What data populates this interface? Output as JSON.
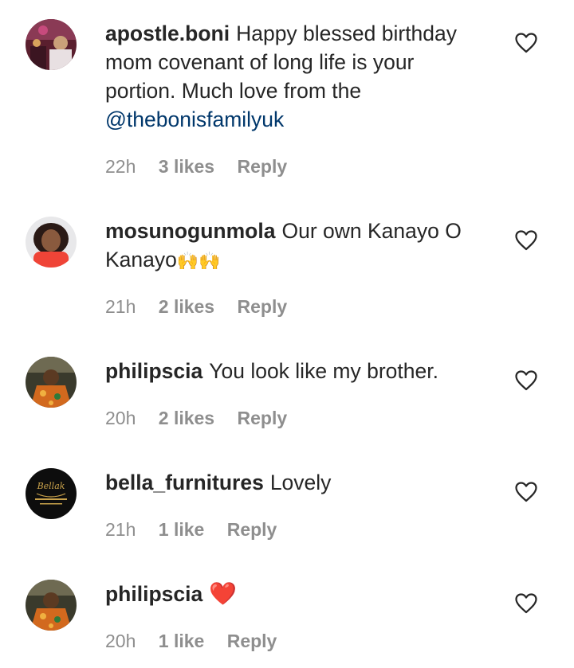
{
  "comments": [
    {
      "username": "apostle.boni",
      "text": "Happy blessed birthday mom covenant of long life is your portion. Much love from the",
      "mention": "@thebonisfamilyuk",
      "time": "22h",
      "likes": "3 likes",
      "reply": "Reply",
      "avatar_icon": "photo-avatar"
    },
    {
      "username": "mosunogunmola",
      "text": "Our own Kanayo O Kanayo",
      "emoji": "🙌🙌",
      "time": "21h",
      "likes": "2 likes",
      "reply": "Reply",
      "avatar_icon": "photo-avatar"
    },
    {
      "username": "philipscia",
      "text": "You look like my brother.",
      "time": "20h",
      "likes": "2 likes",
      "reply": "Reply",
      "avatar_icon": "photo-avatar"
    },
    {
      "username": "bella_furnitures",
      "text": "Lovely",
      "time": "21h",
      "likes": "1 like",
      "reply": "Reply",
      "avatar_icon": "logo-avatar"
    },
    {
      "username": "philipscia",
      "emoji": "❤️",
      "time": "20h",
      "likes": "1 like",
      "reply": "Reply",
      "avatar_icon": "photo-avatar"
    }
  ],
  "colors": {
    "text": "#262626",
    "meta": "#8e8e8e",
    "mention": "#00376b",
    "background": "#ffffff"
  }
}
